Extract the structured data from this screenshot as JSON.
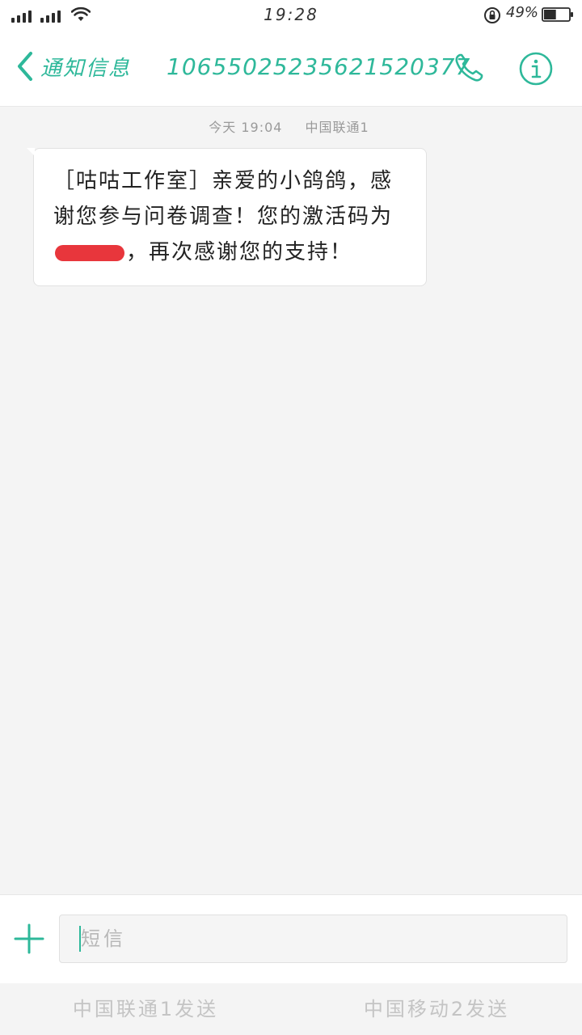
{
  "status_bar": {
    "time": "19:28",
    "battery_percent": "49%",
    "battery_level": 0.49
  },
  "header": {
    "back_label": "通知信息",
    "sender_number": "10655025235621520377",
    "icons": {
      "back": "chevron-left-icon",
      "call": "phone-icon",
      "info": "info-icon"
    }
  },
  "conversation": {
    "timestamp_day": "今天 19:04",
    "timestamp_carrier": "中国联通1",
    "messages": [
      {
        "text_before_redaction": "［咕咕工作室］亲爱的小鸽鸽，感谢您参与问卷调查！您的激活码为",
        "text_after_redaction": "，再次感谢您的支持！"
      }
    ]
  },
  "composer": {
    "placeholder": "短信",
    "value": "",
    "add_icon": "plus-icon"
  },
  "send_options": {
    "sim1_label": "中国联通1发送",
    "sim2_label": "中国移动2发送"
  },
  "colors": {
    "accent": "#2eb89a",
    "redaction": "#e8363c"
  }
}
